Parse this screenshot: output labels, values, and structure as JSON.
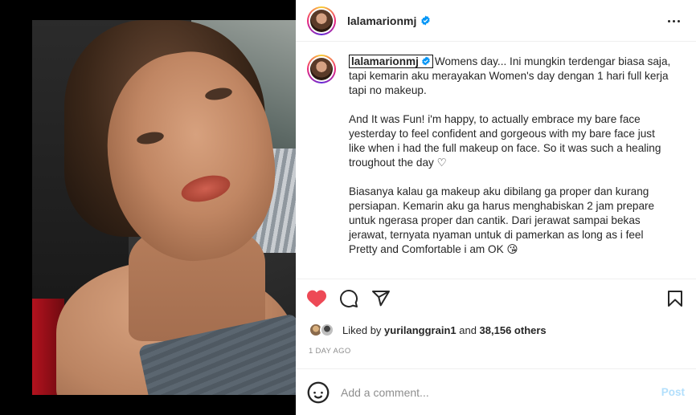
{
  "post": {
    "username": "lalamarionmj",
    "verified_icon": "verified-badge-icon",
    "more_icon": "more-options-icon"
  },
  "caption": {
    "username": "lalamarionmj",
    "paragraphs": [
      "Womens day... Ini mungkin terdengar biasa saja, tapi kemarin aku merayakan Women's day dengan 1 hari full kerja tapi no makeup.",
      "And It was Fun! i'm happy, to actually embrace my bare face yesterday to feel confident and gorgeous with my bare face just like when i had the full makeup on face. So it was such a healing troughout the day ♡",
      "Biasanya kalau ga makeup aku dibilang ga proper dan kurang persiapan. Kemarin aku ga harus menghabiskan 2 jam prepare untuk ngerasa proper dan cantik. Dari jerawat sampai bekas jerawat, ternyata nyaman untuk di pamerkan as long as i feel Pretty and Comfortable i am OK 😘"
    ]
  },
  "actions": {
    "like_icon": "heart-filled-icon",
    "comment_icon": "comment-icon",
    "share_icon": "share-icon",
    "save_icon": "bookmark-icon",
    "like_color": "#ed4956"
  },
  "likes": {
    "prefix": "Liked by ",
    "user": "yurilanggrain1",
    "middle": " and ",
    "count": "38,156 others"
  },
  "time": "1 DAY AGO",
  "comment": {
    "placeholder": "Add a comment...",
    "post_label": "Post",
    "emoji_icon": "emoji-icon"
  },
  "colors": {
    "text": "#262626",
    "muted": "#8e8e8e",
    "post_disabled": "#b2dffc",
    "verified": "#0095f6"
  }
}
